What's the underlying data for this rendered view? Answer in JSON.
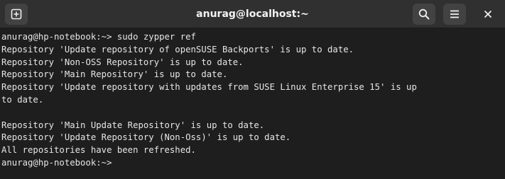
{
  "window": {
    "title": "anurag@localhost:~"
  },
  "titlebar": {
    "new_tab_icon": "plus-square-icon",
    "search_icon": "search-icon",
    "menu_icon": "hamburger-menu-icon",
    "close_icon": "close-icon"
  },
  "terminal": {
    "lines": [
      "anurag@hp-notebook:~> sudo zypper ref",
      "Repository 'Update repository of openSUSE Backports' is up to date.",
      "Repository 'Non-OSS Repository' is up to date.",
      "Repository 'Main Repository' is up to date.",
      "Repository 'Update repository with updates from SUSE Linux Enterprise 15' is up",
      "to date.",
      "",
      "Repository 'Main Update Repository' is up to date.",
      "Repository 'Update Repository (Non-Oss)' is up to date.",
      "All repositories have been refreshed.",
      "anurag@hp-notebook:~>"
    ]
  },
  "colors": {
    "background": "#1e1e1e",
    "titlebar": "#303030",
    "button": "#424242",
    "text": "#e6e6e6"
  }
}
